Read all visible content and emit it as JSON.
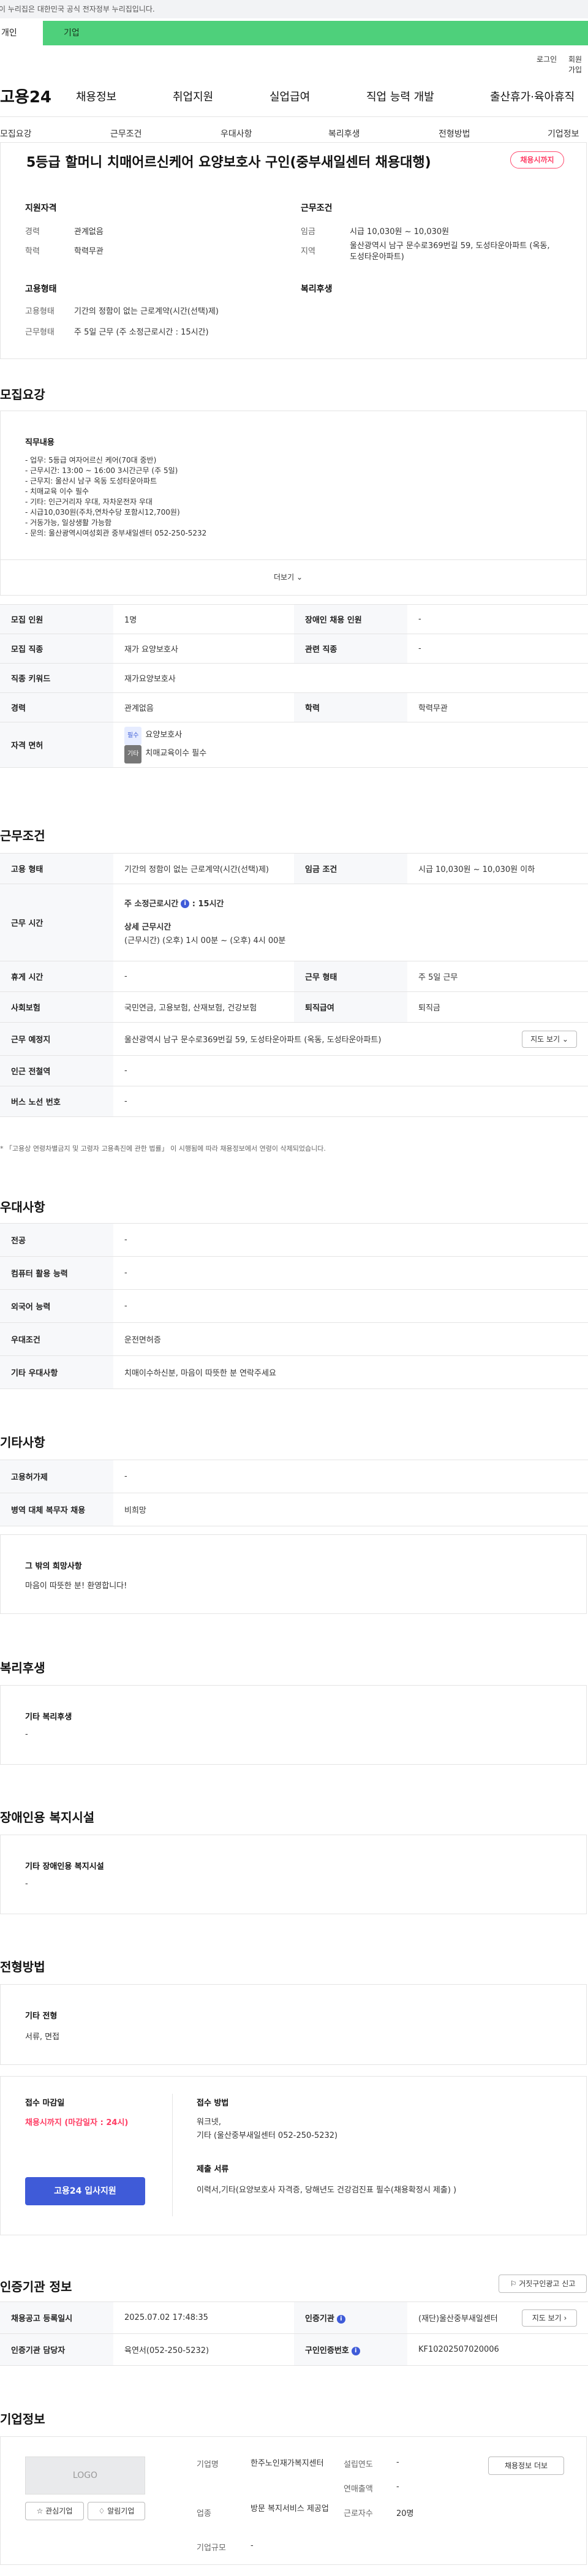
{
  "top": {
    "gov_notice": "이 누리집은 대한민국 공식 전자정부 누리집입니다.",
    "tab_personal": "개인",
    "tab_company": "기업"
  },
  "util": {
    "login": "로그인",
    "signup": "회원가입"
  },
  "header": {
    "logo": "고용24",
    "menu": [
      "채용정보",
      "취업지원",
      "실업급여",
      "직업 능력 개발",
      "출산휴가·육아휴직"
    ]
  },
  "lnb": [
    "모집요강",
    "근무조건",
    "우대사항",
    "복리후생",
    "전형방법",
    "기업정보"
  ],
  "summary": {
    "title": "5등급 할머니 치매어르신케어 요양보호사 구인(중부새일센터 채용대행)",
    "badge": "채용시까지",
    "qual_title": "지원자격",
    "qual": [
      {
        "label": "경력",
        "value": "관계없음"
      },
      {
        "label": "학력",
        "value": "학력무관"
      }
    ],
    "cond_title": "근무조건",
    "cond": [
      {
        "label": "임금",
        "value": "시급 10,030원 ~ 10,030원"
      },
      {
        "label": "지역",
        "value": "울산광역시 남구 문수로369번길 59, 도성타운아파트 (옥동, 도성타운아파트)"
      }
    ],
    "emp_title": "고용형태",
    "emp": [
      {
        "label": "고용형태",
        "value": "기간의 정함이 없는 근로계약(시간(선택)제)"
      },
      {
        "label": "근무형태",
        "value": "주 5일 근무 (주 소정근로시간 : 15시간)"
      }
    ],
    "welfare_title": "복리후생"
  },
  "recruit": {
    "section": "모집요강",
    "duty_title": "직무내용",
    "duty_lines": [
      "- 업무: 5등급 여자어르신 케어(70대 중반)",
      "- 근무시간: 13:00 ~ 16:00 3시간근무 (주 5일)",
      "- 근무지: 울산시 남구 옥동 도성타운아파트",
      "- 치매교육 이수 필수",
      "- 기타: 인근거리자 우대, 자차운전자 우대",
      "- 시급10,030원(주차,연차수당 포함시12,700원)",
      "- 거동가능, 일상생활 가능함",
      "- 문의: 울산광역시여성회관 중부새일센터 052-250-5232"
    ],
    "more": "더보기",
    "rows": [
      {
        "th1": "모집 인원",
        "td1": "1명",
        "th2": "장애인 채용 인원",
        "td2": "-"
      },
      {
        "th1": "모집 직종",
        "td1": "재가 요양보호사",
        "th2": "관련 직종",
        "td2": "-"
      },
      {
        "th1": "직종 키워드",
        "td1": "재가요양보호사"
      },
      {
        "th1": "경력",
        "td1": "관계없음",
        "th2": "학력",
        "td2": "학력무관"
      }
    ],
    "license_th": "자격 면허",
    "license": [
      {
        "tag": "필수",
        "value": "요양보호사"
      },
      {
        "tag": "기타",
        "value": "치매교육이수 필수"
      }
    ]
  },
  "work": {
    "section": "근무조건",
    "type_th": "고용 형태",
    "type_td": "기간의 정함이 없는 근로계약(시간(선택)제)",
    "wage_th": "임금 조건",
    "wage_td": "시급 10,030원 ~ 10,030원 이하",
    "time_th": "근무 시간",
    "time_week": "주 소정근로시간",
    "time_week_val": ": 15시간",
    "time_detail_title": "상세 근무시간",
    "time_detail": "(근무시간) (오후) 1시 00분 ~ (오후) 4시 00분",
    "rest_th": "휴게 시간",
    "rest_td": "-",
    "form_th": "근무 형태",
    "form_td": "주 5일 근무",
    "ins_th": "사회보험",
    "ins_td": "국민연금, 고용보험, 산재보험, 건강보험",
    "sev_th": "퇴직급여",
    "sev_td": "퇴직금",
    "place_th": "근무 예정지",
    "place_td": "울산광역시 남구 문수로369번길 59, 도성타운아파트 (옥동, 도성타운아파트)",
    "map_btn": "지도 보기",
    "subway_th": "인근 전철역",
    "subway_td": "-",
    "bus_th": "버스 노선 번호",
    "bus_td": "-",
    "note": "* 「고용상 연령차별금지 및 고령자 고용촉진에 관한 법률」 이 시행됨에 따라 채용정보에서 연령이 삭제되었습니다."
  },
  "pref": {
    "section": "우대사항",
    "rows": [
      {
        "th": "전공",
        "td": "-"
      },
      {
        "th": "컴퓨터 활용 능력",
        "td": "-"
      },
      {
        "th": "외국어 능력",
        "td": "-"
      },
      {
        "th": "우대조건",
        "td": "운전면허증"
      },
      {
        "th": "기타 우대사항",
        "td": "치매이수하신분, 마음이 따뜻한 분 연락주세요"
      }
    ]
  },
  "etc": {
    "section": "기타사항",
    "rows": [
      {
        "th": "고용허가제",
        "td": "-"
      },
      {
        "th": "병역 대체 복무자 채용",
        "td": "비희망"
      }
    ],
    "wish_title": "그 밖의 희망사항",
    "wish": "마음이 따뜻한 분! 환영합니다!"
  },
  "welfare": {
    "section": "복리후생",
    "title": "기타 복리후생",
    "value": "-"
  },
  "disabled": {
    "section": "장애인용 복지시설",
    "title": "기타 장애인용 복지시설",
    "value": "-"
  },
  "screening": {
    "section": "전형방법",
    "etc_title": "기타 전형",
    "etc_value": "서류, 면접",
    "deadline_title": "접수 마감일",
    "deadline_value": "채용시까지 (마감일자 : 24시)",
    "apply_btn": "고용24 입사지원",
    "method_title": "접수 방법",
    "method_value": "워크넷,\n기타 (울산중부새일센터 052-250-5232)",
    "docs_title": "제출 서류",
    "docs_value": "이력서,기타(요양보호사 자격증, 당해년도 건강검진표 필수(채용확정시 제출) )"
  },
  "cert": {
    "section": "인증기관 정보",
    "report_btn": "거짓구인광고 신고",
    "reg_th": "채용공고 등록일시",
    "reg_td": "2025.07.02 17:48:35",
    "org_th": "인증기관",
    "org_td": "(재단)울산중부새일센터",
    "map_btn": "지도 보기",
    "mgr_th": "인증기관 담당자",
    "mgr_td": "육연서(052-250-5232)",
    "num_th": "구인인증번호",
    "num_td": "KF10202507020006"
  },
  "company": {
    "section": "기업정보",
    "logo_text": "LOGO",
    "fav_btn": "관심기업",
    "alarm_btn": "알림기업",
    "name_lbl": "기업명",
    "name_val": "한주노인재가복지센터",
    "year_lbl": "설립연도",
    "year_val": "-",
    "sales_lbl": "연매출액",
    "sales_val": "-",
    "ind_lbl": "업종",
    "ind_val": "방문 복지서비스 제공업",
    "emp_lbl": "근로자수",
    "emp_val": "20명",
    "scale_lbl": "기업규모",
    "scale_val": "-",
    "jobs_btn": "채용정보 더보"
  },
  "colors": {
    "brand": "#4ed07b",
    "accent_red": "#ff3b62",
    "primary_blue": "#3f5bd8"
  }
}
